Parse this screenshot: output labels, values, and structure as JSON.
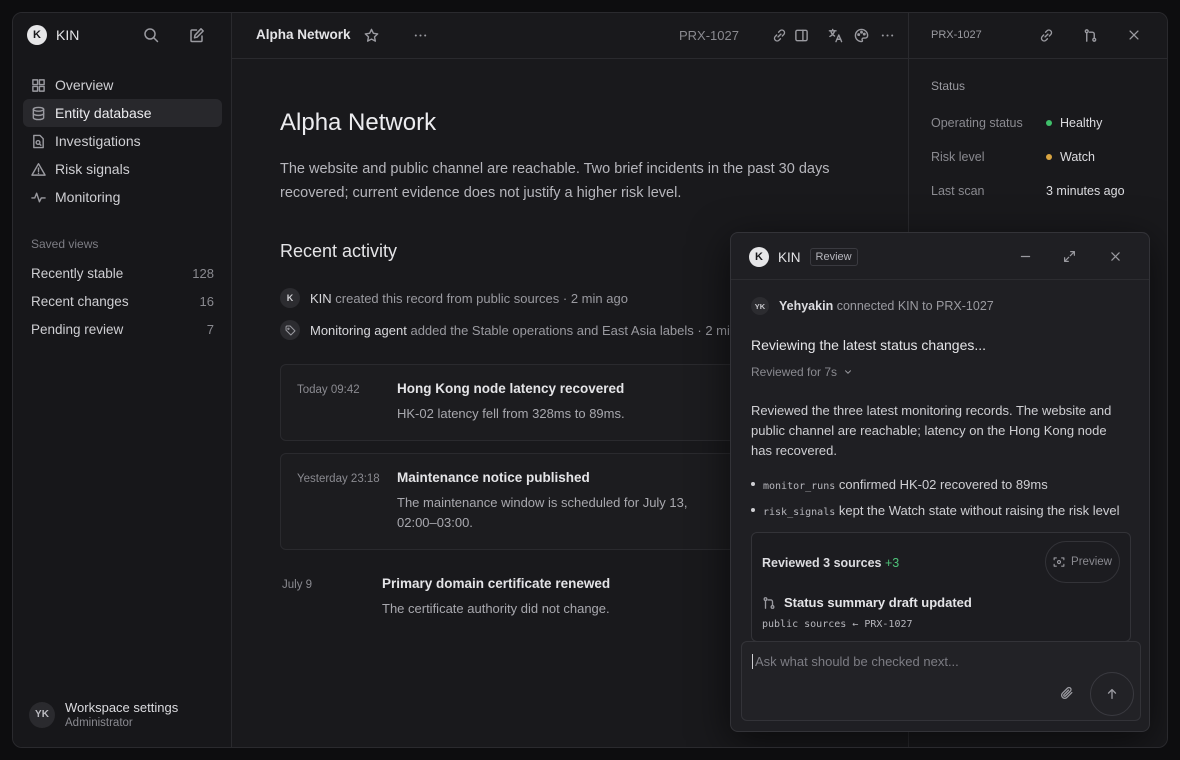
{
  "app": {
    "name": "KIN",
    "logo_letter": "K"
  },
  "sidebar": {
    "nav": [
      {
        "label": "Overview",
        "icon": "grid-icon"
      },
      {
        "label": "Entity database",
        "icon": "database-icon",
        "active": true
      },
      {
        "label": "Investigations",
        "icon": "document-search-icon"
      },
      {
        "label": "Risk signals",
        "icon": "warning-icon"
      },
      {
        "label": "Monitoring",
        "icon": "pulse-icon"
      }
    ],
    "saved_views_title": "Saved views",
    "saved_views": [
      {
        "label": "Recently stable",
        "count": "128"
      },
      {
        "label": "Recent changes",
        "count": "16"
      },
      {
        "label": "Pending review",
        "count": "7"
      }
    ],
    "user": {
      "initials": "YK",
      "name": "Workspace settings",
      "role": "Administrator"
    }
  },
  "main": {
    "tab_title": "Alpha Network",
    "record_id": "PRX-1027",
    "title": "Alpha Network",
    "summary": "The website and public channel are reachable. Two brief incidents in the past 30 days recovered; current evidence does not justify a higher risk level.",
    "activity_title": "Recent activity",
    "activity": [
      {
        "actor": "KIN",
        "text": "created this record from public sources · 2 min ago"
      },
      {
        "actor": "Monitoring agent",
        "text": "added the Stable operations and East Asia labels · 2 mi"
      }
    ],
    "events": [
      {
        "time": "Today 09:42",
        "title": "Hong Kong node latency recovered",
        "desc": "HK-02 latency fell from 328ms to 89ms."
      },
      {
        "time": "Yesterday 23:18",
        "title": "Maintenance notice published",
        "desc": "The maintenance window is scheduled for July 13, 02:00–03:00."
      },
      {
        "time": "July 9",
        "title": "Primary domain certificate renewed",
        "desc": "The certificate authority did not change."
      }
    ]
  },
  "right_panel": {
    "record_id": "PRX-1027",
    "status_title": "Status",
    "props": [
      {
        "label": "Operating status",
        "value": "Healthy",
        "dot": "#3fbf6a"
      },
      {
        "label": "Risk level",
        "value": "Watch",
        "dot": "#d9a441"
      },
      {
        "label": "Last scan",
        "value": "3 minutes ago"
      }
    ]
  },
  "review": {
    "name": "KIN",
    "badge": "Review",
    "connect": {
      "initials": "YK",
      "user": "Yehyakin",
      "text": "connected KIN to PRX-1027"
    },
    "reviewing": "Reviewing the latest status changes...",
    "reviewed_for": "Reviewed for 7s",
    "body": "Reviewed the three latest monitoring records. The website and public channel are reachable; latency on the Hong Kong node has recovered.",
    "bullets": [
      {
        "code": "monitor_runs",
        "text": "confirmed HK-02 recovered to 89ms"
      },
      {
        "code": "risk_signals",
        "text": "kept the Watch state without raising the risk level"
      }
    ],
    "sources": {
      "title": "Reviewed 3 sources",
      "plus": "+3",
      "preview": "Preview"
    },
    "draft": {
      "title": "Status summary draft updated",
      "path": "public sources ← PRX-1027"
    },
    "composer_placeholder": "Ask what should be checked next..."
  }
}
